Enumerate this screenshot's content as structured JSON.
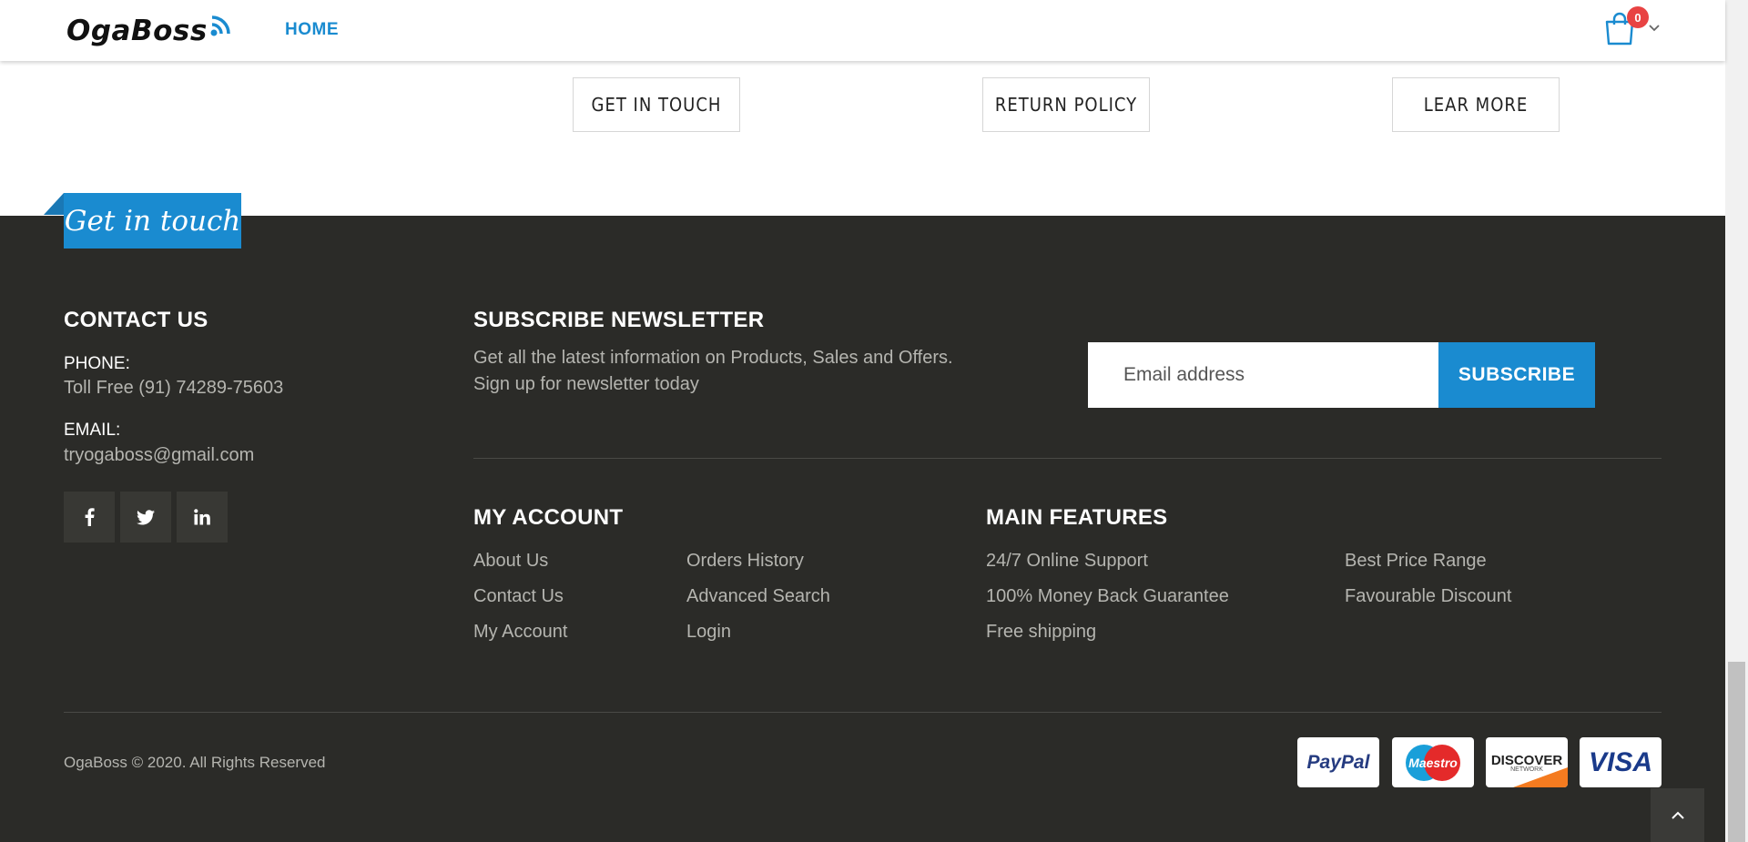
{
  "header": {
    "logo": "OgaBoss",
    "nav_home": "HOME",
    "cart_count": "0"
  },
  "info_buttons": [
    "GET IN TOUCH",
    "RETURN POLICY",
    "LEAR MORE"
  ],
  "footer": {
    "tab_label": "Get in touch",
    "contact": {
      "heading": "CONTACT US",
      "phone_label": "PHONE:",
      "phone_value": "Toll Free (91) 74289-75603",
      "email_label": "EMAIL:",
      "email_value": "tryogaboss@gmail.com",
      "social_icons": [
        "facebook-icon",
        "twitter-icon",
        "linkedin-icon"
      ]
    },
    "newsletter": {
      "heading": "SUBSCRIBE NEWSLETTER",
      "line1": "Get all the latest information on Products, Sales and Offers.",
      "line2": "Sign up for newsletter today",
      "placeholder": "Email address",
      "button": "SUBSCRIBE"
    },
    "my_account": {
      "heading": "MY ACCOUNT",
      "col1": [
        "About Us",
        "Contact Us",
        "My Account"
      ],
      "col2": [
        "Orders History",
        "Advanced Search",
        "Login"
      ]
    },
    "main_features": {
      "heading": "MAIN FEATURES",
      "col1": [
        "24/7 Online Support",
        "100% Money Back Guarantee",
        "Free shipping"
      ],
      "col2": [
        "Best Price Range",
        "Favourable Discount"
      ]
    },
    "copyright": "OgaBoss © 2020. All Rights Reserved",
    "payments": {
      "paypal": "PayPal",
      "maestro": "Maestro",
      "discover": "DISCOVER",
      "discover_sub": "NETWORK",
      "visa": "VISA"
    }
  },
  "colors": {
    "accent": "#1a8bd0",
    "footer_bg": "#2b2b28",
    "badge": "#e84343"
  }
}
